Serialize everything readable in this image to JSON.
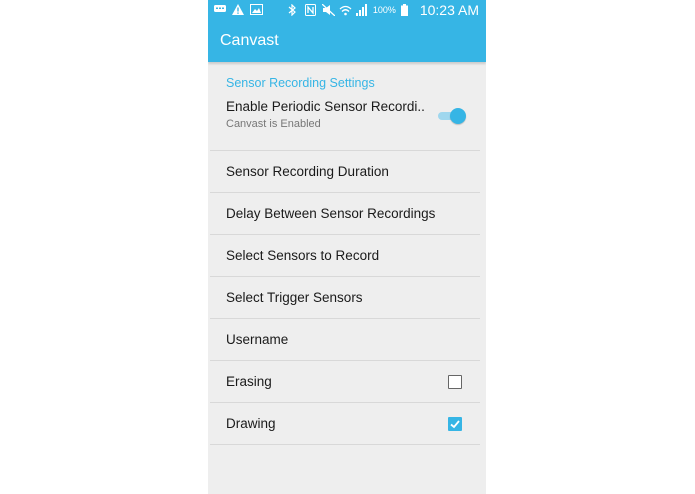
{
  "status_bar": {
    "battery_percent": "100%",
    "time": "10:23 AM",
    "icons": [
      "message-icon",
      "warning-icon",
      "image-icon",
      "bluetooth-icon",
      "nfc-icon",
      "mute-icon",
      "wifi-icon",
      "signal-icon",
      "battery-icon"
    ]
  },
  "action_bar": {
    "title": "Canvast"
  },
  "settings": {
    "section_header": "Sensor Recording Settings",
    "enable": {
      "label": "Enable Periodic Sensor Recordi..",
      "summary": "Canvast is Enabled",
      "on": true
    },
    "items": [
      {
        "label": "Sensor Recording Duration"
      },
      {
        "label": "Delay Between Sensor Recordings"
      },
      {
        "label": "Select Sensors to Record"
      },
      {
        "label": "Select Trigger Sensors"
      },
      {
        "label": "Username"
      }
    ],
    "erasing": {
      "label": "Erasing",
      "checked": false
    },
    "drawing": {
      "label": "Drawing",
      "checked": true
    }
  },
  "colors": {
    "accent": "#36b5e5",
    "background": "#eeeeee",
    "divider": "#d8d8d8"
  }
}
